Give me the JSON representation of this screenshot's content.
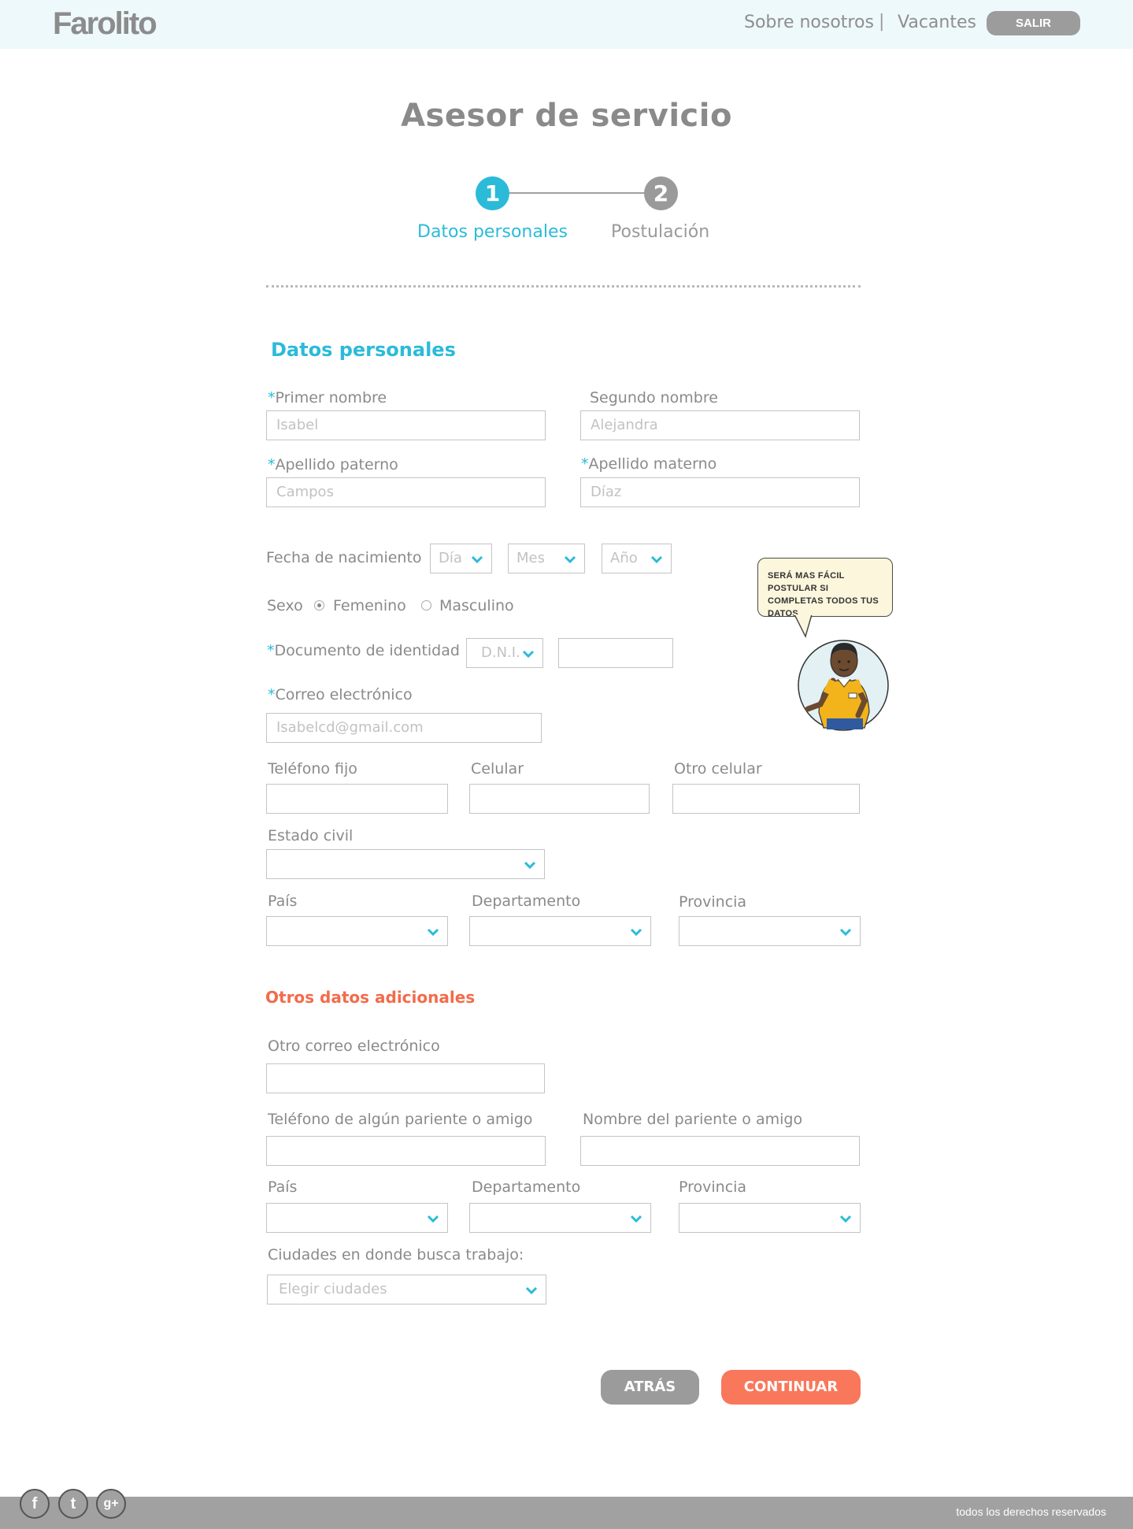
{
  "header": {
    "logo": "Farolito",
    "nav": [
      "Sobre nosotros",
      "Vacantes"
    ],
    "separator": "|",
    "logout_label": "SALIR"
  },
  "page": {
    "title": "Asesor de servicio",
    "steps": [
      {
        "number": "1",
        "label": "Datos personales",
        "active": true
      },
      {
        "number": "2",
        "label": "Postulación",
        "active": false
      }
    ]
  },
  "personal": {
    "title": "Datos personales",
    "first_name": {
      "label": "Primer nombre",
      "required": "*",
      "value": "Isabel"
    },
    "second_name": {
      "label": "Segundo nombre",
      "value": "Alejandra"
    },
    "paternal": {
      "label": "Apellido paterno",
      "required": "*",
      "value": "Campos"
    },
    "maternal": {
      "label": "Apellido materno",
      "required": "*",
      "value": "Díaz"
    },
    "birth": {
      "label": "Fecha de nacimiento",
      "day": "Día",
      "month": "Mes",
      "year": "Año"
    },
    "sex": {
      "label": "Sexo",
      "female": "Femenino",
      "male": "Masculino",
      "selected": "Femenino"
    },
    "document": {
      "label": "Documento de identidad",
      "required": "*",
      "type": "D.N.I.",
      "number": ""
    },
    "email": {
      "label": "Correo electrónico",
      "required": "*",
      "value": "Isabelcd@gmail.com"
    },
    "phone": {
      "label": "Teléfono fijo",
      "value": ""
    },
    "mobile": {
      "label": "Celular",
      "value": ""
    },
    "other_mobile": {
      "label": "Otro celular",
      "value": ""
    },
    "civil": {
      "label": "Estado civil",
      "value": ""
    },
    "country": {
      "label": "País",
      "value": ""
    },
    "department": {
      "label": "Departamento",
      "value": ""
    },
    "province": {
      "label": "Provincia",
      "value": ""
    }
  },
  "tip": "SERÁ MAS FÁCIL POSTULAR SI COMPLETAS TODOS TUS DATOS",
  "additional": {
    "title": "Otros datos adicionales",
    "other_email": {
      "label": "Otro correo electrónico",
      "value": ""
    },
    "relative_phone": {
      "label": "Teléfono de algún pariente o amigo",
      "value": ""
    },
    "relative_name": {
      "label": "Nombre del pariente o amigo",
      "value": ""
    },
    "country": {
      "label": "País",
      "value": ""
    },
    "department": {
      "label": "Departamento",
      "value": ""
    },
    "province": {
      "label": "Provincia",
      "value": ""
    },
    "cities": {
      "label": "Ciudades en donde busca trabajo:",
      "placeholder": "Elegir ciudades"
    }
  },
  "actions": {
    "back": "ATRÁS",
    "next": "CONTINUAR"
  },
  "footer": {
    "copyright": "todos los derechos reservados",
    "social": [
      {
        "icon": "facebook-icon",
        "glyph": "f"
      },
      {
        "icon": "twitter-icon",
        "glyph": "t"
      },
      {
        "icon": "google-plus-icon",
        "glyph": "g+"
      }
    ]
  },
  "colors": {
    "accent": "#2bbbd9",
    "secondary": "#f36b4a",
    "cta": "#f9775b",
    "neutral": "#9b9b9b"
  }
}
